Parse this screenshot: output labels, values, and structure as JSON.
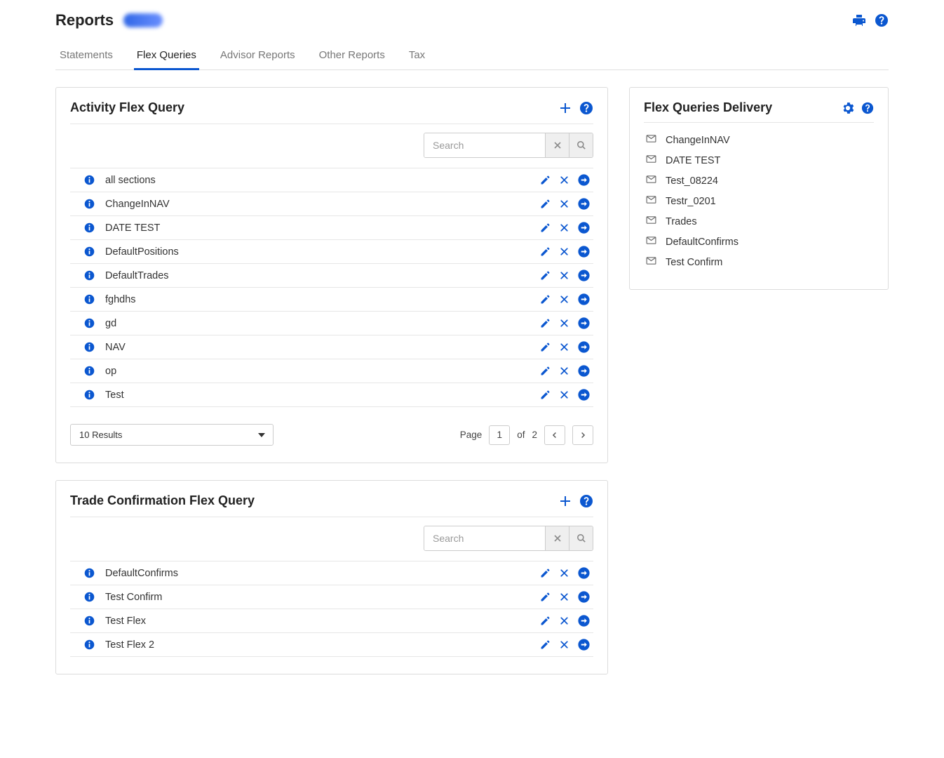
{
  "header": {
    "title": "Reports"
  },
  "tabs": [
    {
      "label": "Statements",
      "active": false
    },
    {
      "label": "Flex Queries",
      "active": true
    },
    {
      "label": "Advisor Reports",
      "active": false
    },
    {
      "label": "Other Reports",
      "active": false
    },
    {
      "label": "Tax",
      "active": false
    }
  ],
  "activity": {
    "title": "Activity Flex Query",
    "search_placeholder": "Search",
    "rows": [
      "all sections",
      "ChangeInNAV",
      "DATE TEST",
      "DefaultPositions",
      "DefaultTrades",
      "fghdhs",
      "gd",
      "NAV",
      "op",
      "Test"
    ],
    "results_select": "10 Results",
    "pager": {
      "label": "Page",
      "current": "1",
      "of": "of",
      "total": "2"
    }
  },
  "trade": {
    "title": "Trade Confirmation Flex Query",
    "search_placeholder": "Search",
    "rows": [
      "DefaultConfirms",
      "Test Confirm",
      "Test Flex",
      "Test Flex 2"
    ]
  },
  "delivery": {
    "title": "Flex Queries Delivery",
    "items": [
      "ChangeInNAV",
      "DATE TEST",
      "Test_08224",
      "Testr_0201",
      "Trades",
      "DefaultConfirms",
      "Test Confirm"
    ]
  }
}
